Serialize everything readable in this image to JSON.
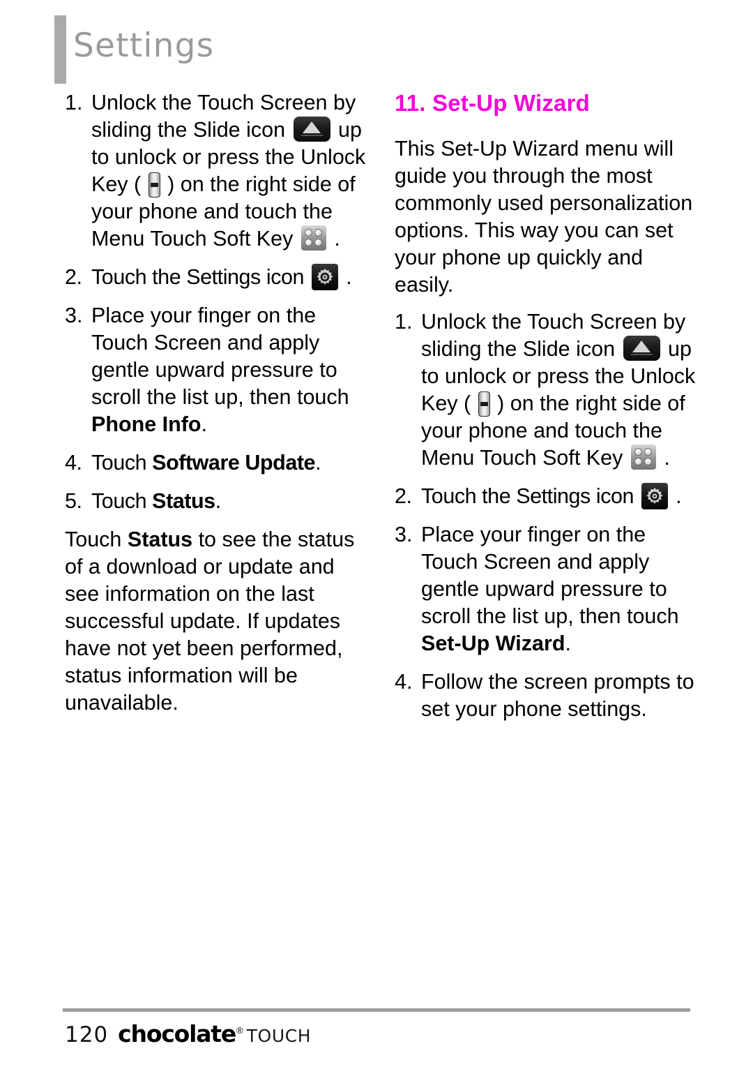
{
  "header": {
    "title": "Settings"
  },
  "left_column": {
    "steps": [
      {
        "num": "1.",
        "parts": [
          {
            "t": "text",
            "v": "Unlock the Touch Screen by sliding the Slide icon "
          },
          {
            "t": "icon",
            "v": "slide-icon"
          },
          {
            "t": "text",
            "v": " up to unlock or press the Unlock Key ( "
          },
          {
            "t": "icon",
            "v": "unlock-key-icon"
          },
          {
            "t": "text",
            "v": " ) on the right side of your phone and touch the Menu Touch Soft Key "
          },
          {
            "t": "icon",
            "v": "menu-soft-key-icon"
          },
          {
            "t": "text",
            "v": " ."
          }
        ]
      },
      {
        "num": "2.",
        "condensed": true,
        "parts": [
          {
            "t": "text",
            "v": "Touch the Settings icon "
          },
          {
            "t": "icon",
            "v": "settings-gear-icon"
          },
          {
            "t": "text",
            "v": " ."
          }
        ]
      },
      {
        "num": "3.",
        "parts": [
          {
            "t": "text",
            "v": "Place your finger on the Touch Screen and apply gentle upward pressure to scroll the list up, then touch "
          },
          {
            "t": "bold",
            "v": "Phone Info"
          },
          {
            "t": "text",
            "v": "."
          }
        ]
      },
      {
        "num": "4.",
        "condensed": true,
        "parts": [
          {
            "t": "text",
            "v": "Touch "
          },
          {
            "t": "bold",
            "v": "Software Update"
          },
          {
            "t": "text",
            "v": "."
          }
        ]
      },
      {
        "num": "5.",
        "condensed": true,
        "parts": [
          {
            "t": "text",
            "v": "Touch "
          },
          {
            "t": "bold",
            "v": "Status"
          },
          {
            "t": "text",
            "v": "."
          }
        ]
      }
    ],
    "closing_paragraph": [
      {
        "t": "text",
        "v": "Touch "
      },
      {
        "t": "bold",
        "v": "Status"
      },
      {
        "t": "text",
        "v": " to see the status of a download or update and see information on the last successful update. If updates have not yet been performed, status information will be unavailable."
      }
    ]
  },
  "right_column": {
    "section_title": "11. Set-Up Wizard",
    "intro_paragraph": "This Set-Up Wizard menu will guide you through the most commonly used personalization options. This way you can set your phone up quickly and easily.",
    "steps": [
      {
        "num": "1.",
        "parts": [
          {
            "t": "text",
            "v": "Unlock the Touch Screen by sliding the Slide icon "
          },
          {
            "t": "icon",
            "v": "slide-icon"
          },
          {
            "t": "text",
            "v": " up to unlock or press the Unlock Key ( "
          },
          {
            "t": "icon",
            "v": "unlock-key-icon"
          },
          {
            "t": "text",
            "v": " ) on the right side of your phone and touch the Menu Touch Soft Key "
          },
          {
            "t": "icon",
            "v": "menu-soft-key-icon"
          },
          {
            "t": "text",
            "v": " ."
          }
        ]
      },
      {
        "num": "2.",
        "condensed": true,
        "parts": [
          {
            "t": "text",
            "v": "Touch the Settings icon "
          },
          {
            "t": "icon",
            "v": "settings-gear-icon"
          },
          {
            "t": "text",
            "v": " ."
          }
        ]
      },
      {
        "num": "3.",
        "parts": [
          {
            "t": "text",
            "v": "Place your finger on the Touch Screen and apply gentle upward pressure to scroll the list up, then touch "
          },
          {
            "t": "bold",
            "v": "Set-Up Wizard"
          },
          {
            "t": "text",
            "v": "."
          }
        ]
      },
      {
        "num": "4.",
        "parts": [
          {
            "t": "text",
            "v": "Follow the screen prompts to set your phone settings."
          }
        ]
      }
    ]
  },
  "footer": {
    "page_number": "120",
    "brand_name": "chocolate",
    "brand_registered": "®",
    "brand_suffix": "TOUCH"
  },
  "colors": {
    "accent_magenta": "#f500d8",
    "header_gray": "#9a9a9a",
    "rule_gray": "#9e9e9e"
  }
}
